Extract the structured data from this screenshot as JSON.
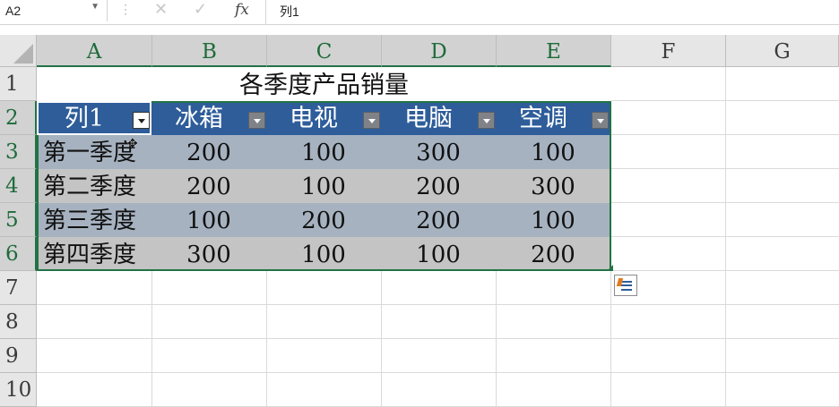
{
  "formula_bar": {
    "name_box": "A2",
    "content": "列1",
    "fx_label": "fx"
  },
  "columns": [
    "A",
    "B",
    "C",
    "D",
    "E",
    "F",
    "G"
  ],
  "rows": [
    "1",
    "2",
    "3",
    "4",
    "5",
    "6",
    "7",
    "8",
    "9",
    "10"
  ],
  "sheet": {
    "title": "各季度产品销量",
    "table": {
      "headers": [
        "列1",
        "冰箱",
        "电视",
        "电脑",
        "空调"
      ],
      "rows": [
        [
          "第一季度",
          "200",
          "100",
          "300",
          "100"
        ],
        [
          "第二季度",
          "200",
          "100",
          "200",
          "300"
        ],
        [
          "第三季度",
          "100",
          "200",
          "200",
          "100"
        ],
        [
          "第四季度",
          "300",
          "100",
          "100",
          "200"
        ]
      ]
    }
  },
  "colors": {
    "header_fill": "#2e5d9a",
    "band_dark": "#a6b2c0",
    "band_light": "#c4c4c4",
    "selection_green": "#217346"
  },
  "icons": {
    "filter": "filter-dropdown-icon",
    "quick_analysis": "quick-analysis-icon",
    "cancel": "cancel-x-icon",
    "enter": "enter-check-icon",
    "function": "insert-function-icon"
  }
}
